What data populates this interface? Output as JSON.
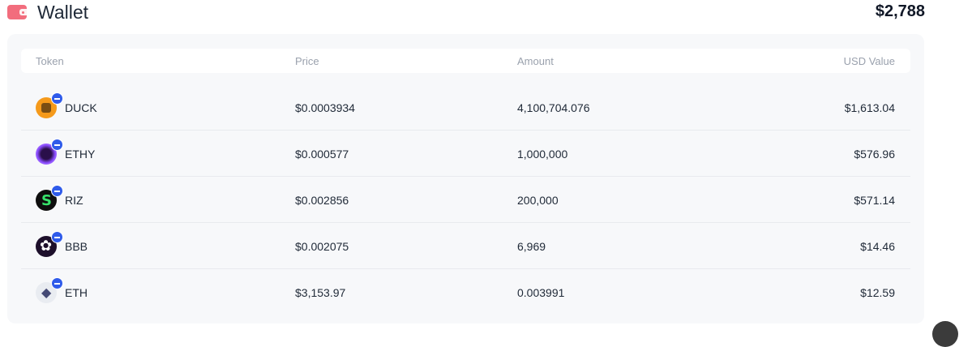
{
  "header": {
    "title": "Wallet",
    "total": "$2,788"
  },
  "table": {
    "columns": [
      "Token",
      "Price",
      "Amount",
      "USD Value"
    ],
    "rows": [
      {
        "token": "DUCK",
        "price": "$0.0003934",
        "amount": "4,100,704.076",
        "usd": "$1,613.04",
        "icon": "duck-token-icon"
      },
      {
        "token": "ETHY",
        "price": "$0.000577",
        "amount": "1,000,000",
        "usd": "$576.96",
        "icon": "ethy-token-icon"
      },
      {
        "token": "RIZ",
        "price": "$0.002856",
        "amount": "200,000",
        "usd": "$571.14",
        "icon": "riz-token-icon"
      },
      {
        "token": "BBB",
        "price": "$0.002075",
        "amount": "6,969",
        "usd": "$14.46",
        "icon": "bbb-token-icon"
      },
      {
        "token": "ETH",
        "price": "$3,153.97",
        "amount": "0.003991",
        "usd": "$12.59",
        "icon": "eth-token-icon"
      }
    ]
  },
  "icons": {
    "wallet": "wallet-icon",
    "chain_badge": "chain-badge-icon"
  },
  "colors": {
    "wallet_icon": "#f26d7d",
    "chain_badge": "#2f5bea",
    "panel_bg": "#f7f8fa",
    "header_text": "#9aa1ad"
  }
}
